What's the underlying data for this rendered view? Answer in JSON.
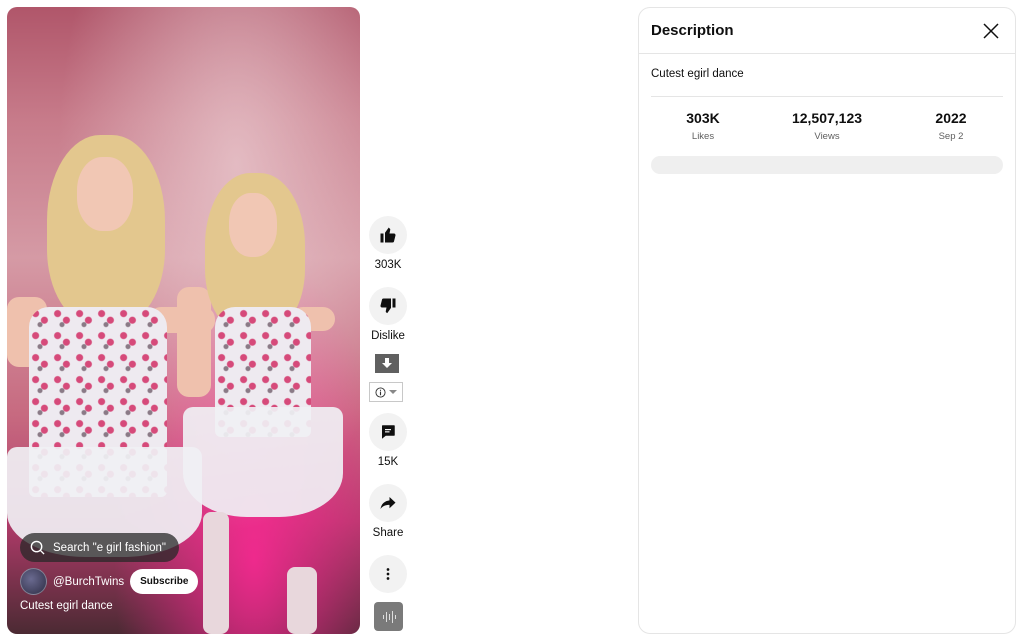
{
  "video": {
    "search_chip": "Search \"e girl fashion\"",
    "channel_handle": "@BurchTwins",
    "subscribe_label": "Subscribe",
    "title": "Cutest egirl dance"
  },
  "actions": {
    "like_count": "303K",
    "dislike_label": "Dislike",
    "comment_count": "15K",
    "share_label": "Share"
  },
  "description_panel": {
    "title": "Description",
    "text": "Cutest egirl dance",
    "stats": [
      {
        "value": "303K",
        "label": "Likes"
      },
      {
        "value": "12,507,123",
        "label": "Views"
      },
      {
        "value": "2022",
        "label": "Sep 2"
      }
    ]
  },
  "icons": {
    "like": "thumb-up-icon",
    "dislike": "thumb-down-icon",
    "comment": "comment-icon",
    "share": "share-icon",
    "more": "more-vertical-icon",
    "close": "close-icon",
    "search": "search-icon"
  },
  "colors": {
    "button_bg": "#f2f2f2",
    "text_primary": "#0f0f0f",
    "text_secondary": "#606060",
    "divider": "#e5e5e5"
  }
}
